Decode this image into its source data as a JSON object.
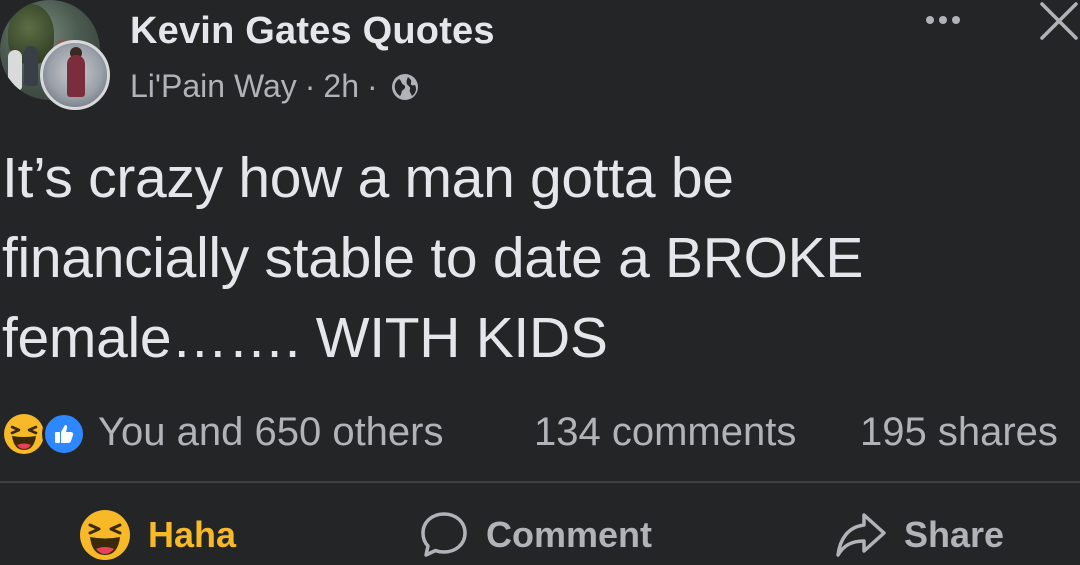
{
  "post": {
    "author": "Kevin Gates Quotes",
    "subtitle": "Li'Pain Way",
    "separator": "·",
    "time": "2h",
    "text": "It’s crazy how a man gotta be\nfinancially stable to date a BROKE\nfemale……. WITH KIDS"
  },
  "header": {
    "more_icon": "more-horizontal-icon",
    "close_icon": "close-icon",
    "audience_icon": "globe-icon"
  },
  "stats": {
    "reactions_text": "You and 650 others",
    "comments_text": "134 comments",
    "shares_text": "195 shares",
    "reaction_icons": [
      "haha-reaction-icon",
      "like-reaction-icon"
    ]
  },
  "actions": {
    "haha_label": "Haha",
    "comment_label": "Comment",
    "share_label": "Share"
  },
  "colors": {
    "background": "#242526",
    "primary_text": "#e4e6eb",
    "secondary_text": "#b0b3b8",
    "haha_yellow": "#f7b928",
    "like_blue": "#2d88ff",
    "divider": "#3e4042"
  }
}
